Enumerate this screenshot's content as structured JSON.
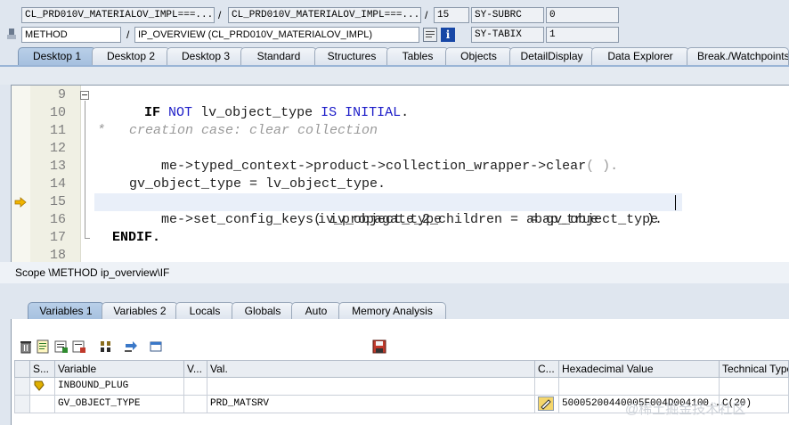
{
  "top_bar": {
    "row1": {
      "program_left": "CL_PRD010V_MATERIALOV_IMPL===...",
      "program_right": "CL_PRD010V_MATERIALOV_IMPL===...",
      "line": "15",
      "sysvar": "SY-SUBRC",
      "sysvar_value": "0"
    },
    "row2": {
      "event_type": "METHOD",
      "event_name": "IP_OVERVIEW (CL_PRD010V_MATERIALOV_IMPL)",
      "sysvar": "SY-TABIX",
      "sysvar_value": "1"
    },
    "separator": "/"
  },
  "desktop_tabs": [
    {
      "label": "Desktop 1",
      "active": true
    },
    {
      "label": "Desktop 2"
    },
    {
      "label": "Desktop 3"
    },
    {
      "label": "Standard"
    },
    {
      "label": "Structures"
    },
    {
      "label": "Tables"
    },
    {
      "label": "Objects"
    },
    {
      "label": "DetailDisplay"
    },
    {
      "label": "Data Explorer"
    },
    {
      "label": "Break./Watchpoints"
    }
  ],
  "editor": {
    "line_numbers": [
      "9",
      "10",
      "11",
      "12",
      "13",
      "14",
      "15",
      "16",
      "17",
      "18"
    ],
    "lines": {
      "l9_a": "IF",
      "l9_b": "NOT",
      "l9_c": "lv_object_type",
      "l9_d": "IS",
      "l9_e": "INITIAL",
      "l9_f": ".",
      "l11": "*   creation case: clear collection",
      "l12_a": "me->typed_context->product->collection_wrapper->clear",
      "l12_b": "( ).",
      "l14": "gv_object_type = lv_object_type.",
      "l15_a": "me->set_config_keys",
      "l15_b": "( iv_object_type           = gv_object_type",
      "l16": "iv_propagate_2_children = abap_true      ).",
      "l17": "ENDIF."
    },
    "current_line": "15"
  },
  "scope": "Scope \\METHOD ip_overview\\IF",
  "var_tabs": [
    {
      "label": "Variables 1",
      "active": true
    },
    {
      "label": "Variables 2"
    },
    {
      "label": "Locals"
    },
    {
      "label": "Globals"
    },
    {
      "label": "Auto"
    },
    {
      "label": "Memory Analysis"
    }
  ],
  "toolbar_icons": [
    "delete-icon",
    "text-view-icon",
    "detail-icon",
    "layout-icon",
    "swap-icon",
    "transfer-icon",
    "new-tab-icon",
    "save-icon"
  ],
  "grid": {
    "headers": [
      "S...",
      "Variable",
      "V...",
      "Val.",
      "C...",
      "Hexadecimal Value",
      "Technical Type"
    ],
    "rows": [
      {
        "variable": "INBOUND_PLUG",
        "value": "",
        "hex": "",
        "type": ""
      },
      {
        "variable": "GV_OBJECT_TYPE",
        "value": "PRD_MATSRV",
        "hex": "50005200440005F004D004100...",
        "type": "C(20)"
      }
    ]
  },
  "watermark": "@稀土掘金技术社区",
  "colors": {
    "keyword": "#1c1cc8",
    "comment": "#9a9a9a",
    "active_tab": "#a6c0df",
    "arrow": "#e8a800"
  }
}
